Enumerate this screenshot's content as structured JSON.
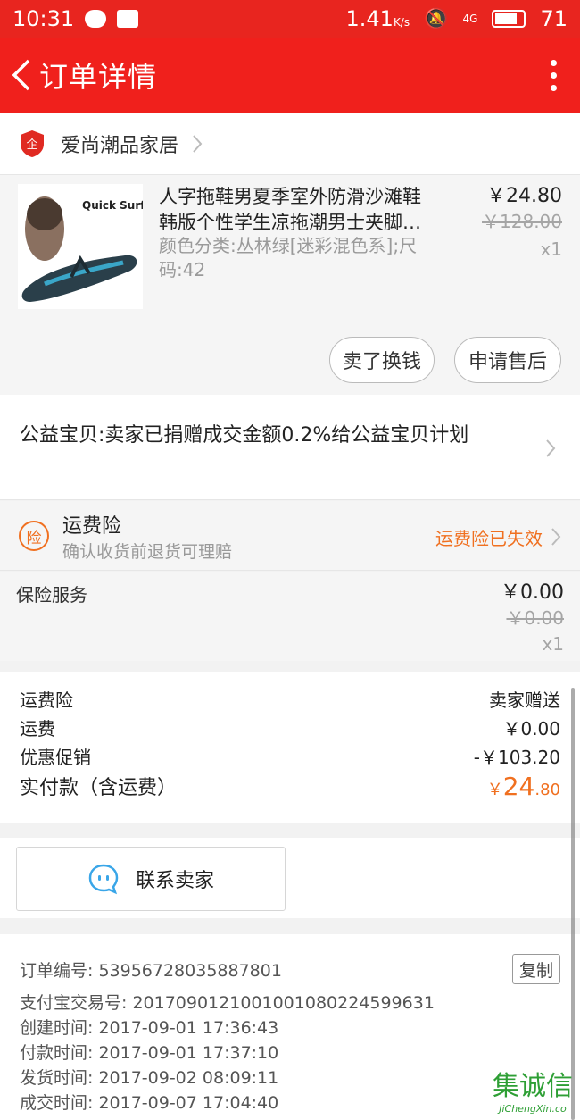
{
  "status_bar": {
    "time": "10:31",
    "speed": "1.41",
    "speed_unit": "K/s",
    "network": "4G",
    "battery": "71"
  },
  "header": {
    "title": "订单详情"
  },
  "shop": {
    "name": "爱尚潮品家居",
    "badge": "企"
  },
  "product": {
    "image_brand": "Quick Surf",
    "title": "人字拖鞋男夏季室外防滑沙滩鞋韩版个性学生凉拖潮男士夹脚…",
    "spec": "颜色分类:丛林绿[迷彩混色系];尺码:42",
    "price": "￥24.80",
    "original_price": "￥128.00",
    "quantity": "x1",
    "sell_button": "卖了换钱",
    "aftersale_button": "申请售后"
  },
  "charity": {
    "text": "公益宝贝:卖家已捐赠成交金额0.2%给公益宝贝计划"
  },
  "insurance": {
    "icon_text": "险",
    "title": "运费险",
    "subtitle": "确认收货前退货可理赔",
    "status": "运费险已失效",
    "status_color": "#f07020"
  },
  "service": {
    "label": "保险服务",
    "price": "￥0.00",
    "original_price": "￥0.00",
    "quantity": "x1"
  },
  "summary": {
    "rows": [
      {
        "label": "运费险",
        "value": "卖家赠送"
      },
      {
        "label": "运费",
        "value": "￥0.00"
      },
      {
        "label": "优惠促销",
        "value": "-￥103.20"
      }
    ],
    "total_label": "实付款（含运费）",
    "total_currency": "￥",
    "total_int": "24",
    "total_dec": ".80"
  },
  "contact": {
    "label": "联系卖家"
  },
  "order_info": {
    "copy_label": "复制",
    "rows": [
      "订单编号: 539567280358878​01",
      "支付宝交易号: 2017090121001001080224599631",
      "创建时间: 2017-09-01 17:36:43",
      "付款时间: 2017-09-01 17:37:10",
      "发货时间: 2017-09-02 08:09:11",
      "成交时间: 2017-09-07 17:04:40"
    ]
  },
  "watermark": {
    "text": "集诚信",
    "url": "JiChengXin.co"
  },
  "colors": {
    "brand_red": "#f0201c",
    "accent_orange": "#f07020"
  }
}
